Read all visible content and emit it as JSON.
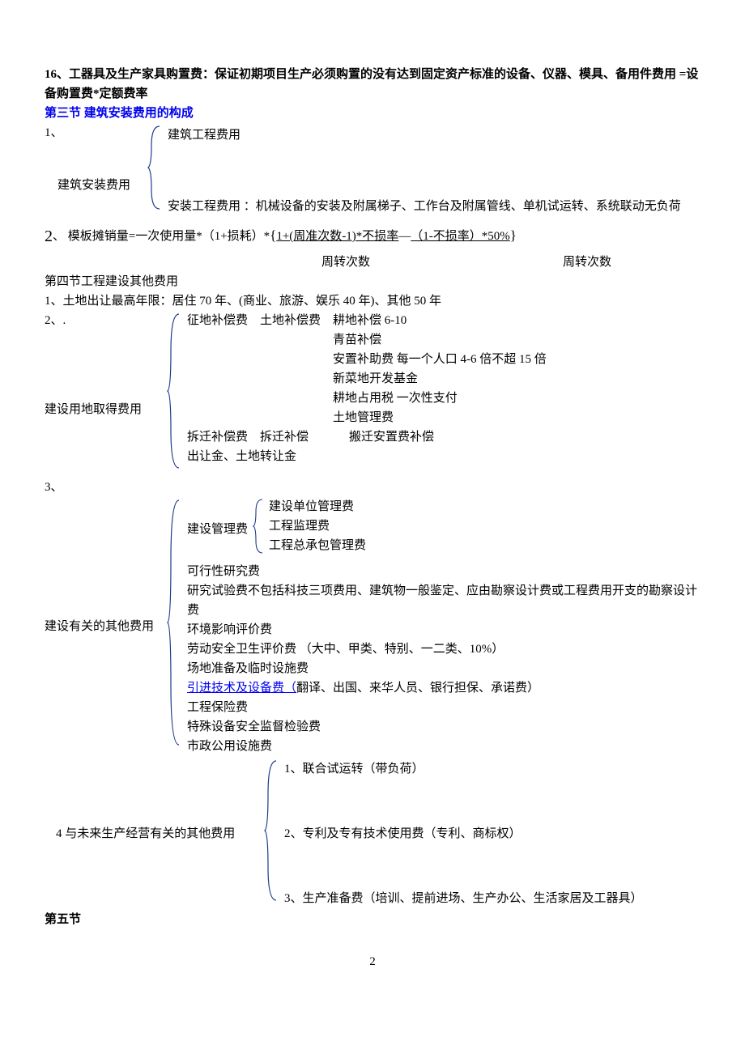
{
  "top": {
    "item16_1": "16、工器具及生产家具购置费：保证初期项目生产必须购置的没有达到固定资产标准的设备、仪器、模具、备用件费用",
    "item16_2": " =设备购置费*定额费率"
  },
  "sec3": {
    "title": "第三节 建筑安装费用的构成",
    "p1": "1、",
    "left": "建筑安装费用",
    "a": "建筑工程费用",
    "b": "安装工程费用 ：机械设备的安装及附属梯子、工作台及附属管线、单机试运转、系统联动无负荷",
    "p2_num": "2",
    "p2_rest": "、 模板摊销量=一次使用量*（1+损耗）*",
    "p2_lb": "{",
    "p2_f1": "1+(周准次数-1)*不损率",
    "p2_mid": "—",
    "p2_f2": "（1-不损率）*50%",
    "p2_rb": "}",
    "p2_d1": "周转次数",
    "p2_d2": "周转次数"
  },
  "sec4": {
    "title": "第四节工程建设其他费用",
    "p1": "1、土地出让最高年限：居住 70 年、(商业、旅游、娱乐 40 年)、其他 50 年",
    "p2": "2、.",
    "group2_label": "建设用地取得费用",
    "g2_a": "征地补偿费",
    "g2_a1": "土地补偿费",
    "g2_a1b": "耕地补偿 6-10",
    "g2_a2": "青苗补偿",
    "g2_a3": "安置补助费 每一个人口 4-6 倍不超 15 倍",
    "g2_a4": "新菜地开发基金",
    "g2_a5": "耕地占用税 一次性支付",
    "g2_a6": "土地管理费",
    "g2_b": "拆迁补偿费",
    "g2_b1": "拆迁补偿",
    "g2_b2": "搬迁安置费补偿",
    "g2_c": "出让金、土地转让金",
    "p3": "3、",
    "group3_label": "建设有关的其他费用",
    "g3_a": "建设管理费",
    "g3_a1": "建设单位管理费",
    "g3_a2": "工程监理费",
    "g3_a3": "工程总承包管理费",
    "g3_b": "可行性研究费",
    "g3_c": "研究试验费不包括科技三项费用、建筑物一般鉴定、应由勘察设计费或工程费用开支的勘察设计费",
    "g3_d": "环境影响评价费",
    "g3_e": "劳动安全卫生评价费 （大中、甲类、特别、一二类、10%）",
    "g3_f": "场地准备及临时设施费",
    "g3_g_link": "引进技术及设备费（",
    "g3_g_rest": "翻译、出国、来华人员、银行担保、承诺费）",
    "g3_h": "工程保险费",
    "g3_i": "特殊设备安全监督检验费",
    "g3_j": "市政公用设施费",
    "p4": "4 与未来生产经营有关的其他费用",
    "g4_a": "1、联合试运转（带负荷）",
    "g4_b": "2、专利及专有技术使用费（专利、商标权）",
    "g4_c": "3、生产准备费（培训、提前进场、生产办公、生活家居及工器具）"
  },
  "sec5": {
    "title": "第五节"
  },
  "page": "2"
}
